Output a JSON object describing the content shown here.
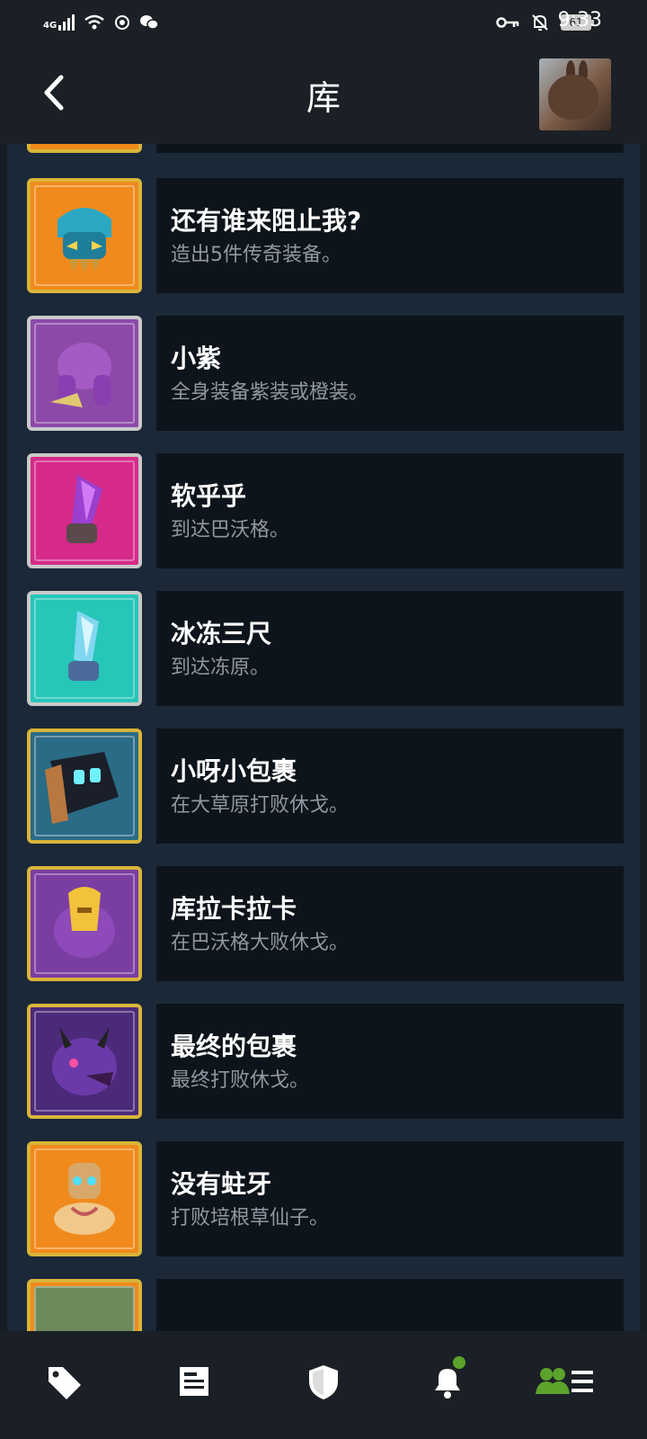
{
  "status_bar": {
    "network": "4G",
    "battery": "61",
    "time": "9:33"
  },
  "header": {
    "title": "库",
    "back_icon": "chevron-left-icon",
    "avatar_icon": "rabbit-avatar"
  },
  "achievements": [
    {
      "name": "还有谁来阻止我?",
      "desc": "造出5件传奇装备。",
      "frame": "#d9b43a",
      "bg": "#f08a1c",
      "icon": "blue-helmet-skull-icon"
    },
    {
      "name": "小紫",
      "desc": "全身装备紫装或橙装。",
      "frame": "#c9c9c9",
      "bg": "#8c4aa8",
      "icon": "purple-brute-icon"
    },
    {
      "name": "软乎乎",
      "desc": "到达巴沃格。",
      "frame": "#c9c9c9",
      "bg": "#d52a8a",
      "icon": "purple-blade-icon"
    },
    {
      "name": "冰冻三尺",
      "desc": "到达冻原。",
      "frame": "#c9c9c9",
      "bg": "#26c6b8",
      "icon": "ice-blade-icon"
    },
    {
      "name": "小呀小包裹",
      "desc": "在大草原打败休戈。",
      "frame": "#d9b43a",
      "bg": "#2a6b86",
      "icon": "robot-box-icon"
    },
    {
      "name": "库拉卡拉卡",
      "desc": "在巴沃格大败休戈。",
      "frame": "#d9b43a",
      "bg": "#7a3da2",
      "icon": "gold-mask-knight-icon"
    },
    {
      "name": "最终的包裹",
      "desc": "最终打败休戈。",
      "frame": "#d9b43a",
      "bg": "#4b2a7a",
      "icon": "purple-demon-icon"
    },
    {
      "name": "没有蛀牙",
      "desc": "打败培根草仙子。",
      "frame": "#d9b43a",
      "bg": "#f08a1c",
      "icon": "meditating-monk-icon"
    }
  ],
  "bottom_nav": [
    {
      "icon": "tag-icon"
    },
    {
      "icon": "news-icon"
    },
    {
      "icon": "shield-icon"
    },
    {
      "icon": "bell-icon"
    },
    {
      "icon": "friends-menu-icon"
    }
  ],
  "colors": {
    "accent_green": "#5ba32b",
    "card_bg": "#0e141b",
    "list_bg": "#1b2838"
  }
}
